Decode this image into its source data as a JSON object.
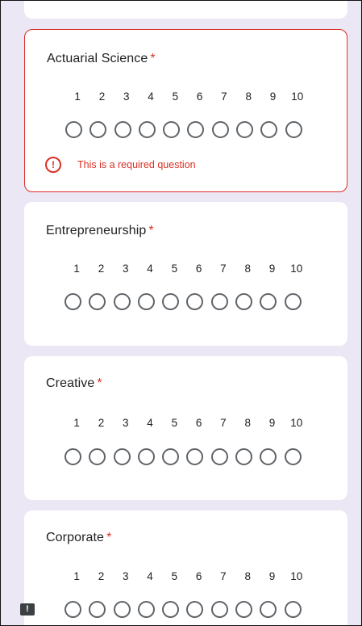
{
  "questions": [
    {
      "title": "Actuarial Science",
      "required_mark": "*",
      "error": "This is a required question"
    },
    {
      "title": "Entrepreneurship",
      "required_mark": "*"
    },
    {
      "title": "Creative",
      "required_mark": "*"
    },
    {
      "title": "Corporate",
      "required_mark": "*"
    }
  ],
  "scale": [
    "1",
    "2",
    "3",
    "4",
    "5",
    "6",
    "7",
    "8",
    "9",
    "10"
  ],
  "icons": {
    "error": "error-circle-icon",
    "feedback": "feedback-icon"
  },
  "colors": {
    "error": "#d93025",
    "background": "#ece7f4",
    "card": "#ffffff"
  }
}
